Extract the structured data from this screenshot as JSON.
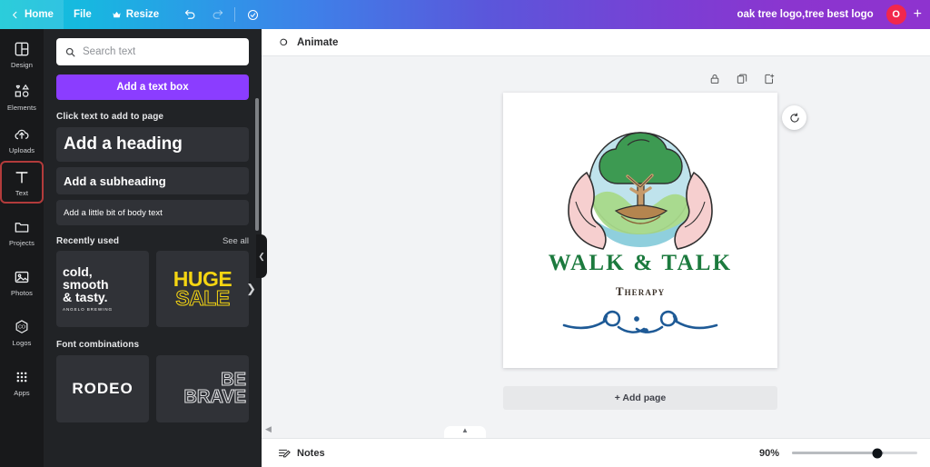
{
  "header": {
    "back_icon": "chevron-left-icon",
    "home_label": "Home",
    "file_label": "File",
    "resize_label": "Resize",
    "resize_icon": "crown-icon",
    "undo_icon": "undo-icon",
    "redo_icon": "redo-icon",
    "cloud_icon": "cloud-check-icon",
    "doc_title": "oak tree logo,tree best logo",
    "avatar_initial": "O",
    "plus_label": "+",
    "gradient_start": "#0ec6d6",
    "gradient_mid": "#4a6ce2",
    "gradient_end": "#8e33cf"
  },
  "rail": {
    "items": [
      {
        "label": "Design",
        "icon": "design-grid-icon",
        "active": false
      },
      {
        "label": "Elements",
        "icon": "elements-shapes-icon",
        "active": false
      },
      {
        "label": "Uploads",
        "icon": "upload-cloud-icon",
        "active": false
      },
      {
        "label": "Text",
        "icon": "text-t-icon",
        "active": true
      },
      {
        "label": "Projects",
        "icon": "folder-icon",
        "active": false
      },
      {
        "label": "Photos",
        "icon": "photo-icon",
        "active": false
      },
      {
        "label": "Logos",
        "icon": "logo-hex-icon",
        "active": false
      },
      {
        "label": "Apps",
        "icon": "apps-grid-icon",
        "active": false
      }
    ],
    "active_outline_color": "#b23b3b"
  },
  "panel": {
    "search": {
      "placeholder": "Search text",
      "value": "",
      "icon": "search-icon"
    },
    "add_textbox_label": "Add a text box",
    "add_textbox_color": "#8b3dff",
    "click_text_label": "Click text to add to page",
    "text_styles": [
      {
        "label": "Add a heading"
      },
      {
        "label": "Add a subheading"
      },
      {
        "label": "Add a little bit of body text"
      }
    ],
    "recently_used": {
      "title": "Recently used",
      "see_all_label": "See all",
      "next_arrow_icon": "chevron-right-icon",
      "items": [
        {
          "name": "cold-smooth-tasty-thumb",
          "line1": "cold,",
          "line2": "smooth",
          "line3": "& tasty.",
          "sub": "ANGELO BREWING"
        },
        {
          "name": "huge-sale-thumb",
          "line1": "HUGE",
          "line2": "SALE",
          "color": "#f5d512"
        }
      ]
    },
    "font_combinations": {
      "title": "Font combinations",
      "items": [
        {
          "name": "rodeo-thumb",
          "line1": "RODEO"
        },
        {
          "name": "be-brave-thumb",
          "line1": "BE",
          "line2": "BRAVE"
        }
      ]
    },
    "collapse_icon": "chevron-left-icon"
  },
  "toolbar": {
    "animate_label": "Animate",
    "animate_icon": "animate-circles-icon"
  },
  "canvas": {
    "tools": [
      {
        "name": "lock-icon",
        "label": "Lock"
      },
      {
        "name": "duplicate-icon",
        "label": "Duplicate"
      },
      {
        "name": "add-page-icon",
        "label": "Add page"
      }
    ],
    "rotate_icon": "rotate-icon",
    "add_page_label": "+ Add page",
    "design": {
      "title": "WALK & TALK",
      "subtitle": "Therapy",
      "title_color": "#1c7a3e",
      "subtitle_color": "#3a3028",
      "flourish_color": "#1e5a96",
      "circle_color": "#bfe3ec",
      "hands_color": "#f6cfcf",
      "tree_color": "#2f8f4d"
    }
  },
  "bottom": {
    "notes_label": "Notes",
    "notes_icon": "notes-pen-icon",
    "zoom_percent": "90%",
    "expand_icon": "chevron-up-icon",
    "prev_page_icon": "chevron-left-small-icon"
  }
}
